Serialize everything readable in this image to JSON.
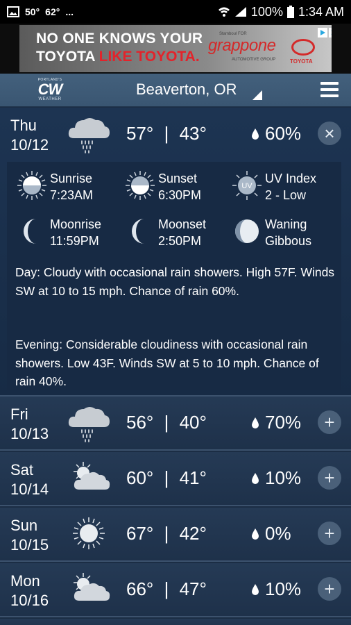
{
  "status_bar": {
    "left_icons": [
      "image-icon"
    ],
    "temp_now": "50°",
    "temp_next": "62°",
    "more": "...",
    "battery": "100%",
    "time": "1:34 AM"
  },
  "ad": {
    "line1": "NO ONE KNOWS YOUR",
    "line2_white": "TOYOTA",
    "line2_red": "LIKE TOYOTA.",
    "dealer_tag": "Stamboul FOR",
    "dealer_name": "grappone",
    "dealer_group": "AUTOMOTIVE GROUP",
    "brand": "TOYOTA",
    "close_symbol": "✕"
  },
  "header": {
    "logo_top": "PORTLAND'S",
    "logo_main": "CW",
    "logo_bottom": "WEATHER",
    "location": "Beaverton, OR"
  },
  "expanded_day": {
    "day": "Thu",
    "date": "10/12",
    "high": "57°",
    "separator": "|",
    "low": "43°",
    "precip": "60%",
    "icon": "rain-cloud-icon",
    "toggle": "×",
    "astro": [
      {
        "name": "sunrise",
        "label": "Sunrise",
        "value": "7:23AM",
        "icon": "sunrise-icon"
      },
      {
        "name": "sunset",
        "label": "Sunset",
        "value": "6:30PM",
        "icon": "sunset-icon"
      },
      {
        "name": "uv",
        "label": "UV Index",
        "value": "2 - Low",
        "icon": "uv-icon"
      },
      {
        "name": "moonrise",
        "label": "Moonrise",
        "value": "11:59PM",
        "icon": "moonrise-icon"
      },
      {
        "name": "moonset",
        "label": "Moonset",
        "value": "2:50PM",
        "icon": "moonset-icon"
      },
      {
        "name": "moon-phase",
        "label": "Waning",
        "value": "Gibbous",
        "icon": "waning-gibbous-icon"
      }
    ],
    "uv_badge": "UV",
    "day_text": "Day: Cloudy with occasional rain showers. High 57F. Winds SW at 10 to 15 mph. Chance of rain 60%.",
    "evening_text": "Evening: Considerable cloudiness with occasional rain showers. Low 43F. Winds SW at 5 to 10 mph. Chance of rain 40%."
  },
  "days": [
    {
      "day": "Fri",
      "date": "10/13",
      "high": "56°",
      "low": "40°",
      "precip": "70%",
      "icon": "rain-cloud-icon",
      "toggle": "+"
    },
    {
      "day": "Sat",
      "date": "10/14",
      "high": "60°",
      "low": "41°",
      "precip": "10%",
      "icon": "partly-cloudy-icon",
      "toggle": "+"
    },
    {
      "day": "Sun",
      "date": "10/15",
      "high": "67°",
      "low": "42°",
      "precip": "0%",
      "icon": "sunny-icon",
      "toggle": "+"
    },
    {
      "day": "Mon",
      "date": "10/16",
      "high": "66°",
      "low": "47°",
      "precip": "10%",
      "icon": "partly-cloudy-icon",
      "toggle": "+"
    }
  ],
  "separator": "|",
  "colors": {
    "background": "#1b2d44",
    "header": "#3f5b77",
    "button": "#4a6079",
    "ad_red": "#e3232b"
  }
}
